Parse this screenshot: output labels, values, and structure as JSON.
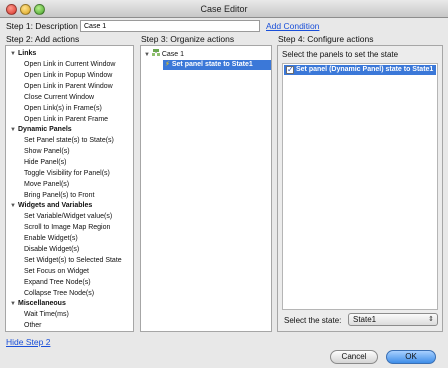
{
  "window": {
    "title": "Case Editor"
  },
  "step1": {
    "label": "Step 1: Description",
    "description_value": "Case 1",
    "add_condition": "Add Condition"
  },
  "step2": {
    "label": "Step 2: Add actions"
  },
  "step3": {
    "label": "Step 3: Organize actions"
  },
  "step4": {
    "label": "Step 4: Configure actions"
  },
  "actions": {
    "links": {
      "title": "Links",
      "items": [
        "Open Link in Current Window",
        "Open Link in Popup Window",
        "Open Link in Parent Window",
        "Close Current Window",
        "Open Link(s) in Frame(s)",
        "Open Link in Parent Frame"
      ]
    },
    "dynamic_panels": {
      "title": "Dynamic Panels",
      "items": [
        "Set Panel state(s) to State(s)",
        "Show Panel(s)",
        "Hide Panel(s)",
        "Toggle Visibility for Panel(s)",
        "Move Panel(s)",
        "Bring Panel(s) to Front"
      ]
    },
    "widgets_variables": {
      "title": "Widgets and Variables",
      "items": [
        "Set Variable/Widget value(s)",
        "Scroll to Image Map Region",
        "Enable Widget(s)",
        "Disable Widget(s)",
        "Set Widget(s) to Selected State",
        "Set Focus on Widget",
        "Expand Tree Node(s)",
        "Collapse Tree Node(s)"
      ]
    },
    "misc": {
      "title": "Miscellaneous",
      "items": [
        "Wait Time(ms)",
        "Other"
      ]
    }
  },
  "organize": {
    "case_name": "Case 1",
    "action": "Set panel state to State1"
  },
  "configure": {
    "heading": "Select the panels to set the state",
    "panel_row": "Set panel (Dynamic Panel) state to State1",
    "state_label": "Select the state:",
    "state_value": "State1"
  },
  "footer": {
    "hide_step": "Hide Step 2",
    "cancel": "Cancel",
    "ok": "OK"
  },
  "colors": {
    "selection": "#3b78d8",
    "link": "#1a4fd8"
  }
}
